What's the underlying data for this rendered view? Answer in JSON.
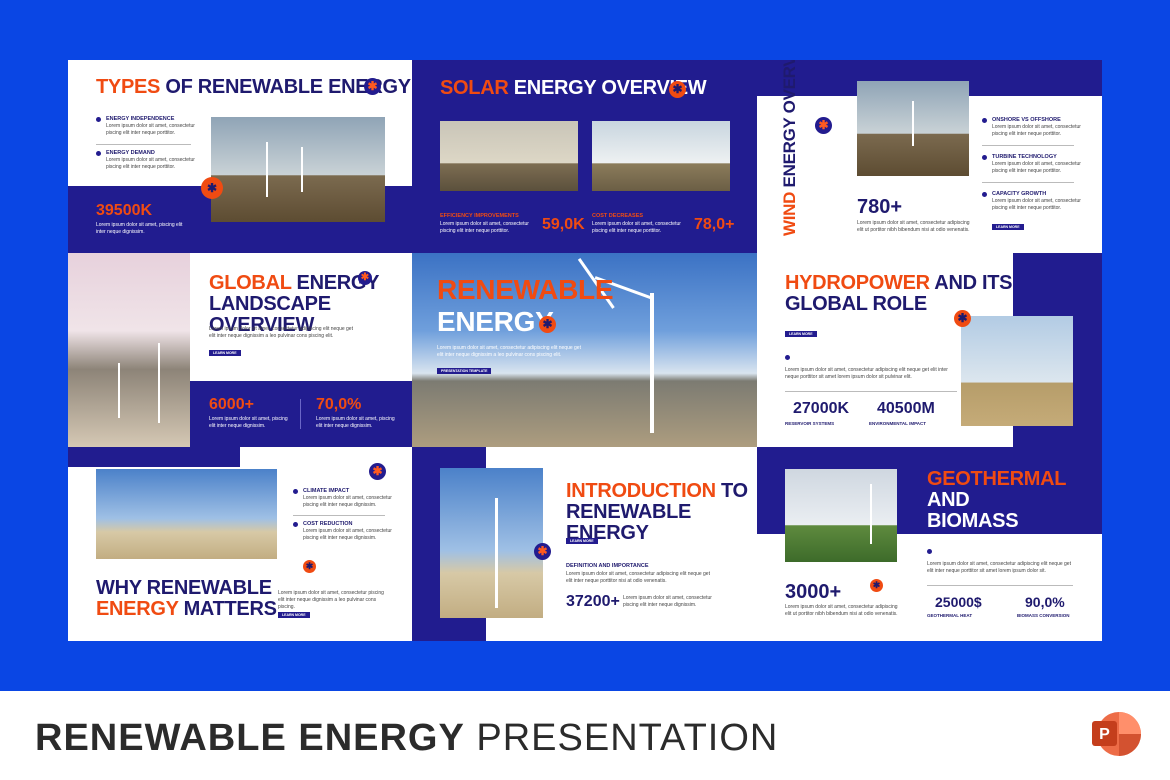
{
  "slides": {
    "types": {
      "title_a": "TYPES",
      "title_b": " OF RENEWABLE ENERGY",
      "item1": "ENERGY INDEPENDENCE",
      "item2": "ENERGY DEMAND",
      "body": "Lorem ipsum dolor sit amet, consectetur piscing elit inter neque porttitor.",
      "stat": "39500K",
      "stat_body": "Lorem ipsum dolor sit amet, piscing elit inter neque dignissim."
    },
    "solar": {
      "title_a": "SOLAR",
      "title_b": " ENERGY OVERVIEW",
      "lbl1": "EFFICIENCY IMPROVEMENTS",
      "val1": "59,0K",
      "lbl2": "COST DECREASES",
      "val2": "78,0+",
      "body": "Lorem ipsum dolor sit amet, consectetur piscing elit inter neque porttitor."
    },
    "wind": {
      "title_a": "WIND",
      "title_b": " ENERGY OVERVIEW",
      "item1": "ONSHORE VS OFFSHORE",
      "item2": "TURBINE TECHNOLOGY",
      "item3": "CAPACITY GROWTH",
      "body": "Lorem ipsum dolor sit amet, consectetur piscing elit inter neque porttitor.",
      "stat": "780+",
      "stat_body": "Lorem ipsum dolor sit amet, consectetur adipiscing elit ut portitor nibh bibendum nisi at odio venenatis.",
      "btn": "LEARN MORE"
    },
    "global": {
      "title_a": "GLOBAL",
      "title_b": " ENERGY",
      "title_c": "LANDSCAPE OVERVIEW",
      "body": "Lorem ipsum dolor sit amet, consectetur adipiscing elit neque get elit inter neque dignissim a leo pulvinar cons piscing elit.",
      "btn": "LEARN MORE",
      "stat1": "6000+",
      "stat2": "70,0%",
      "stat_body": "Lorem ipsum dolor sit amet, piscing elit inter neque dignissim."
    },
    "hero": {
      "title_a": "RENEWABLE",
      "title_b": "ENERGY",
      "body": "Lorem ipsum dolor sit amet, consectetur adipiscing elit neque get elit inter neque dignissim a leo pulvinar cons piscing elit.",
      "tag": "PRESENTATION TEMPLATE"
    },
    "hydro": {
      "title_a": "HYDROPOWER",
      "title_b": " AND ITS",
      "title_c": "GLOBAL ROLE",
      "btn": "LEARN MORE",
      "body": "Lorem ipsum dolor sit amet, consectetur adipiscing elit neque get elit inter neque porttitor sit amet lorem ipsum dolor sit pulvinar elit.",
      "stat1": "27000K",
      "lbl1": "RESERVOIR SYSTEMS",
      "stat2": "40500M",
      "lbl2": "ENVIRONMENTAL IMPACT"
    },
    "why": {
      "item1": "CLIMATE IMPACT",
      "item2": "COST REDUCTION",
      "body": "Lorem ipsum dolor sit amet, consectetur piscing elit inter neque dignissim.",
      "title_a": "WHY RENEWABLE",
      "title_b": "ENERGY",
      "title_c": " MATTERS",
      "body2": "Lorem ipsum dolor sit amet, consectetur piscing elit inter neque dignissim a leo pulvinar cons piscing.",
      "btn": "LEARN MORE"
    },
    "intro": {
      "title_a": "INTRODUCTION",
      "title_b": " TO",
      "title_c": "RENEWABLE ENERGY",
      "btn": "LEARN MORE",
      "lbl": "DEFINITION AND IMPORTANCE",
      "body": "Lorem ipsum dolor sit amet, consectetur adipiscing elit neque get elit inter neque porttitor nisi at odio venenatis.",
      "stat": "37200+",
      "stat_body": "Lorem ipsum dolor sit amet, consectetur piscing elit inter neque dignissim."
    },
    "geo": {
      "title_a": "GEOTHERMAL",
      "title_b": " AND",
      "title_c": "BIOMASS ENERGY",
      "body": "Lorem ipsum dolor sit amet, consectetur adipiscing elit neque get elit inter neque porttitor sit amet lorem ipsum dolor sit.",
      "stat": "3000+",
      "stat_body": "Lorem ipsum dolor sit amet, consectetur adipiscing elit ut portitor nibh bibendum nisi at odio venenatis.",
      "stat1": "25000$",
      "lbl1": "GEOTHERMAL HEAT",
      "stat2": "90,0%",
      "lbl2": "BIOMASS CONVERSION"
    }
  },
  "footer": {
    "title_bold": "RENEWABLE ENERGY",
    "title_light": " PRESENTATION",
    "app_icon": "powerpoint-icon",
    "app_letter": "P"
  },
  "colors": {
    "background": "#0a46e4",
    "navy": "#211c8f",
    "orange": "#f04b12"
  }
}
